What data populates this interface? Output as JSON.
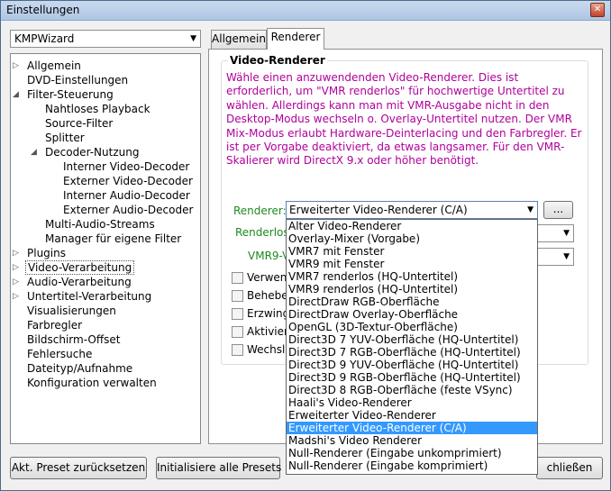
{
  "window": {
    "title": "Einstellungen"
  },
  "preset": {
    "value": "KMPWizard"
  },
  "tree": [
    {
      "label": "Allgemein",
      "expander": "▷"
    },
    {
      "label": "DVD-Einstellungen",
      "expander": ""
    },
    {
      "label": "Filter-Steuerung",
      "expander": "◢"
    },
    {
      "label": "Nahtloses Playback",
      "expander": ""
    },
    {
      "label": "Source-Filter",
      "expander": ""
    },
    {
      "label": "Splitter",
      "expander": ""
    },
    {
      "label": "Decoder-Nutzung",
      "expander": "◢"
    },
    {
      "label": "Interner Video-Decoder",
      "expander": ""
    },
    {
      "label": "Externer Video-Decoder",
      "expander": ""
    },
    {
      "label": "Interner Audio-Decoder",
      "expander": ""
    },
    {
      "label": "Externer Audio-Decoder",
      "expander": ""
    },
    {
      "label": "Multi-Audio-Streams",
      "expander": ""
    },
    {
      "label": "Manager für eigene Filter",
      "expander": ""
    },
    {
      "label": "Plugins",
      "expander": "▷"
    },
    {
      "label": "Video-Verarbeitung",
      "expander": "▷"
    },
    {
      "label": "Audio-Verarbeitung",
      "expander": "▷"
    },
    {
      "label": "Untertitel-Verarbeitung",
      "expander": "▷"
    },
    {
      "label": "Visualisierungen",
      "expander": ""
    },
    {
      "label": "Farbregler",
      "expander": ""
    },
    {
      "label": "Bildschirm-Offset",
      "expander": ""
    },
    {
      "label": "Fehlersuche",
      "expander": ""
    },
    {
      "label": "Dateityp/Aufnahme",
      "expander": ""
    },
    {
      "label": "Konfiguration verwalten",
      "expander": ""
    }
  ],
  "tabs": [
    {
      "label": "Allgemein"
    },
    {
      "label": "Renderer"
    }
  ],
  "group": {
    "title": "Video-Renderer",
    "description": "Wähle einen anzuwendenden Video-Renderer. Dies ist erforderlich, um \"VMR renderlos\" für hochwertige Untertitel zu wählen. Allerdings kann man mit VMR-Ausgabe nicht in den Desktop-Modus wechseln o. Overlay-Untertitel nutzen. Der VMR Mix-Modus erlaubt Hardware-Deinterlacing und den Farbregler. Er ist per Vorgabe deaktiviert, da etwas langsamer. Für den VMR-Skalierer wird DirectX 9.x oder höher benötigt."
  },
  "renderer": {
    "label": "Renderer:",
    "value": "Erweiterter Video-Renderer (C/A)",
    "dots_label": "...",
    "renderless_label": "Renderlose",
    "vmr9_label": "VMR9-V"
  },
  "checkboxes": [
    {
      "label": "Verwen"
    },
    {
      "label": "Behebe"
    },
    {
      "label": "Erzwing"
    },
    {
      "label": "Aktiviere"
    },
    {
      "label": "Wechsle"
    }
  ],
  "dropdown": {
    "selected_index": 14,
    "options": [
      "Alter Video-Renderer",
      "Overlay-Mixer (Vorgabe)",
      "VMR7 mit Fenster",
      "VMR9 mit Fenster",
      "VMR7 renderlos (HQ-Untertitel)",
      "VMR9 renderlos (HQ-Untertitel)",
      "DirectDraw RGB-Oberfläche",
      "DirectDraw Overlay-Oberfläche",
      "OpenGL (3D-Textur-Oberfläche)",
      "Direct3D 7 YUV-Oberfläche (HQ-Untertitel)",
      "Direct3D 7 RGB-Oberfläche (HQ-Untertitel)",
      "Direct3D 9 YUV-Oberfläche (HQ-Untertitel)",
      "Direct3D 9 RGB-Oberfläche (HQ-Untertitel)",
      "Direct3D 8 RGB-Oberfläche (feste VSync)",
      "Haali's Video-Renderer",
      "Erweiterter Video-Renderer",
      "Erweiterter Video-Renderer (C/A)",
      "Madshi's Video Renderer",
      "Null-Renderer (Eingabe unkomprimiert)",
      "Null-Renderer (Eingabe komprimiert)"
    ]
  },
  "buttons": {
    "reset": "Akt. Preset zurücksetzen",
    "init": "Initialisiere alle Presets",
    "close": "chließen"
  }
}
